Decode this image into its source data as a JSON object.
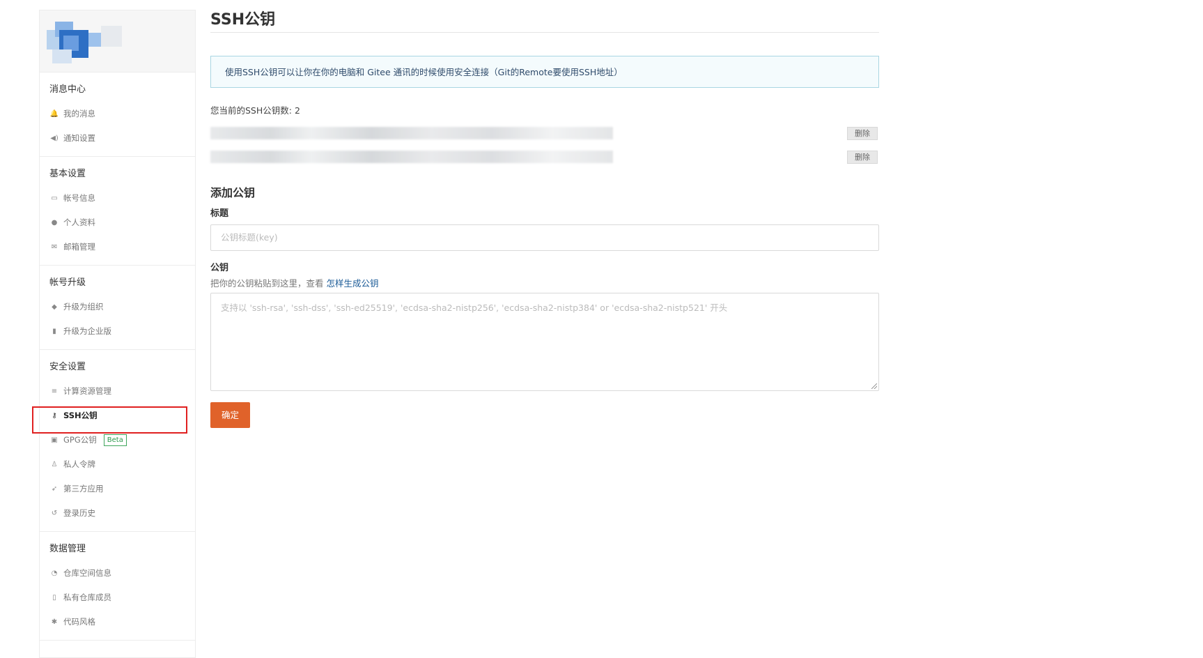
{
  "sidebar": {
    "groups": [
      {
        "title": "消息中心",
        "items": [
          {
            "label": "我的消息",
            "icon": "bell-icon"
          },
          {
            "label": "通知设置",
            "icon": "speaker-icon"
          }
        ]
      },
      {
        "title": "基本设置",
        "items": [
          {
            "label": "帐号信息",
            "icon": "id-card-icon"
          },
          {
            "label": "个人资料",
            "icon": "user-icon"
          },
          {
            "label": "邮箱管理",
            "icon": "mail-icon"
          }
        ]
      },
      {
        "title": "帐号升级",
        "items": [
          {
            "label": "升级为组织",
            "icon": "users-icon"
          },
          {
            "label": "升级为企业版",
            "icon": "building-icon"
          }
        ]
      },
      {
        "title": "安全设置",
        "items": [
          {
            "label": "计算资源管理",
            "icon": "server-icon"
          },
          {
            "label": "SSH公钥",
            "icon": "key-icon"
          },
          {
            "label": "GPG公钥",
            "icon": "lock-icon",
            "badge": "Beta"
          },
          {
            "label": "私人令牌",
            "icon": "token-icon"
          },
          {
            "label": "第三方应用",
            "icon": "rocket-icon"
          },
          {
            "label": "登录历史",
            "icon": "history-icon"
          }
        ]
      },
      {
        "title": "数据管理",
        "items": [
          {
            "label": "仓库空间信息",
            "icon": "pie-chart-icon"
          },
          {
            "label": "私有仓库成员",
            "icon": "book-icon"
          },
          {
            "label": "代码风格",
            "icon": "gears-icon"
          }
        ]
      }
    ]
  },
  "main": {
    "title": "SSH公钥",
    "info": "使用SSH公钥可以让你在你的电脑和 Gitee 通讯的时候使用安全连接（Git的Remote要使用SSH地址）",
    "key_count": "您当前的SSH公钥数: 2",
    "delete_label": "删除",
    "add_title": "添加公钥",
    "title_label": "标题",
    "title_placeholder": "公钥标题(key)",
    "key_label": "公钥",
    "key_hint_prefix": "把你的公钥粘贴到这里，查看",
    "key_hint_link": "怎样生成公钥",
    "key_placeholder": "支持以 'ssh-rsa', 'ssh-dss', 'ssh-ed25519', 'ecdsa-sha2-nistp256', 'ecdsa-sha2-nistp384' or 'ecdsa-sha2-nistp521' 开头",
    "submit_label": "确定"
  },
  "colors": {
    "accent": "#e0622a",
    "info_border": "#a9d6e2",
    "beta_green": "#3fa55c",
    "highlight_red": "#e02020"
  }
}
